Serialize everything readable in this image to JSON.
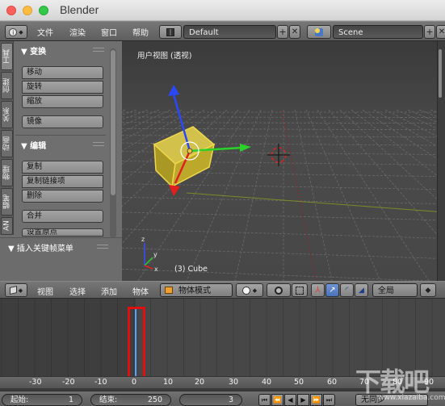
{
  "window": {
    "title": "Blender"
  },
  "info_header": {
    "menus": [
      "文件",
      "渲染",
      "窗口",
      "帮助"
    ],
    "layout": "Default",
    "scene": "Scene"
  },
  "tool_shelf": {
    "tabs": [
      "工具",
      "创建",
      "关系",
      "动画",
      "物理",
      "蜡笔",
      "AN"
    ],
    "sections": [
      {
        "title": "▼ 变换",
        "buttons": [
          "移动",
          "旋转",
          "缩放"
        ],
        "extra": "镜像"
      },
      {
        "title": "▼ 编辑",
        "buttons": [
          "复制",
          "复制链接项",
          "删除"
        ],
        "extra": "合并",
        "partial": "设置原点"
      }
    ],
    "footer": "▼ 插入关键帧菜单"
  },
  "viewport": {
    "label": "用户视图 (透视)",
    "object": "(3) Cube",
    "axis_labels": [
      "z",
      "y",
      "x"
    ]
  },
  "view3d_header": {
    "menus": [
      "视图",
      "选择",
      "添加",
      "物体"
    ],
    "mode": "物体模式",
    "pivot": "全局"
  },
  "timeline": {
    "ticks": [
      "-30",
      "-20",
      "-10",
      "0",
      "10",
      "20",
      "30",
      "40",
      "50",
      "60",
      "70",
      "80",
      "90"
    ],
    "current_frame": 0
  },
  "playback": {
    "start_label": "起始:",
    "start_value": "1",
    "end_label": "结束:",
    "end_value": "250",
    "current": "3",
    "sync": "无同步"
  },
  "watermark": {
    "text": "下载吧",
    "url": "www.xiazaiba.com"
  },
  "colors": {
    "accent": "#5680c2",
    "highlight": "#e01010",
    "cube": "#c8b43a"
  }
}
